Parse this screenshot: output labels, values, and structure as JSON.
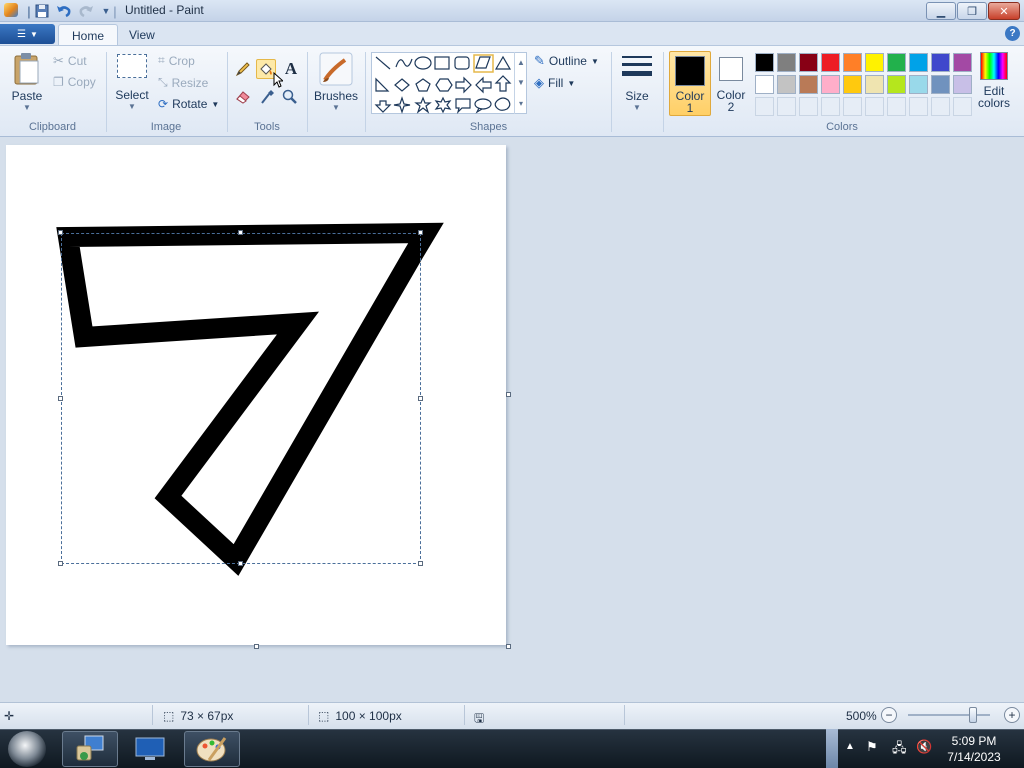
{
  "window": {
    "title": "Untitled - Paint"
  },
  "tabs": [
    {
      "label": "Home",
      "active": true
    },
    {
      "label": "View",
      "active": false
    }
  ],
  "ribbon": {
    "clipboard": {
      "paste": "Paste",
      "cut": "Cut",
      "copy": "Copy",
      "group_label": "Clipboard"
    },
    "image": {
      "select": "Select",
      "crop": "Crop",
      "resize": "Resize",
      "rotate": "Rotate",
      "group_label": "Image"
    },
    "tools": {
      "group_label": "Tools",
      "items": [
        "pencil-icon",
        "fill-icon",
        "text-icon",
        "eraser-icon",
        "color-picker-icon",
        "magnifier-icon"
      ]
    },
    "brushes": {
      "label": "Brushes"
    },
    "shapes": {
      "group_label": "Shapes",
      "outline": "Outline",
      "fill": "Fill"
    },
    "size": {
      "label": "Size"
    },
    "colors": {
      "color1_label": "Color",
      "color1_num": "1",
      "color2_label": "Color",
      "color2_num": "2",
      "color1_value": "#000000",
      "color2_value": "#ffffff",
      "edit_colors_line1": "Edit",
      "edit_colors_line2": "colors",
      "group_label": "Colors",
      "palette_row1": [
        "#000000",
        "#7f7f7f",
        "#880015",
        "#ed1c24",
        "#ff7f27",
        "#fff200",
        "#22b14c",
        "#00a2e8",
        "#3f48cc",
        "#a349a4"
      ],
      "palette_row2": [
        "#ffffff",
        "#c3c3c3",
        "#b97a57",
        "#ffaec9",
        "#ffc90e",
        "#efe4b0",
        "#b5e61d",
        "#99d9ea",
        "#7092be",
        "#c8bfe7"
      ]
    }
  },
  "status": {
    "selection_size": "73 × 67px",
    "canvas_size": "100 × 100px",
    "zoom": "500%",
    "zoom_level_fraction": 0.82
  },
  "taskbar": {
    "time": "5:09 PM",
    "date": "7/14/2023"
  }
}
